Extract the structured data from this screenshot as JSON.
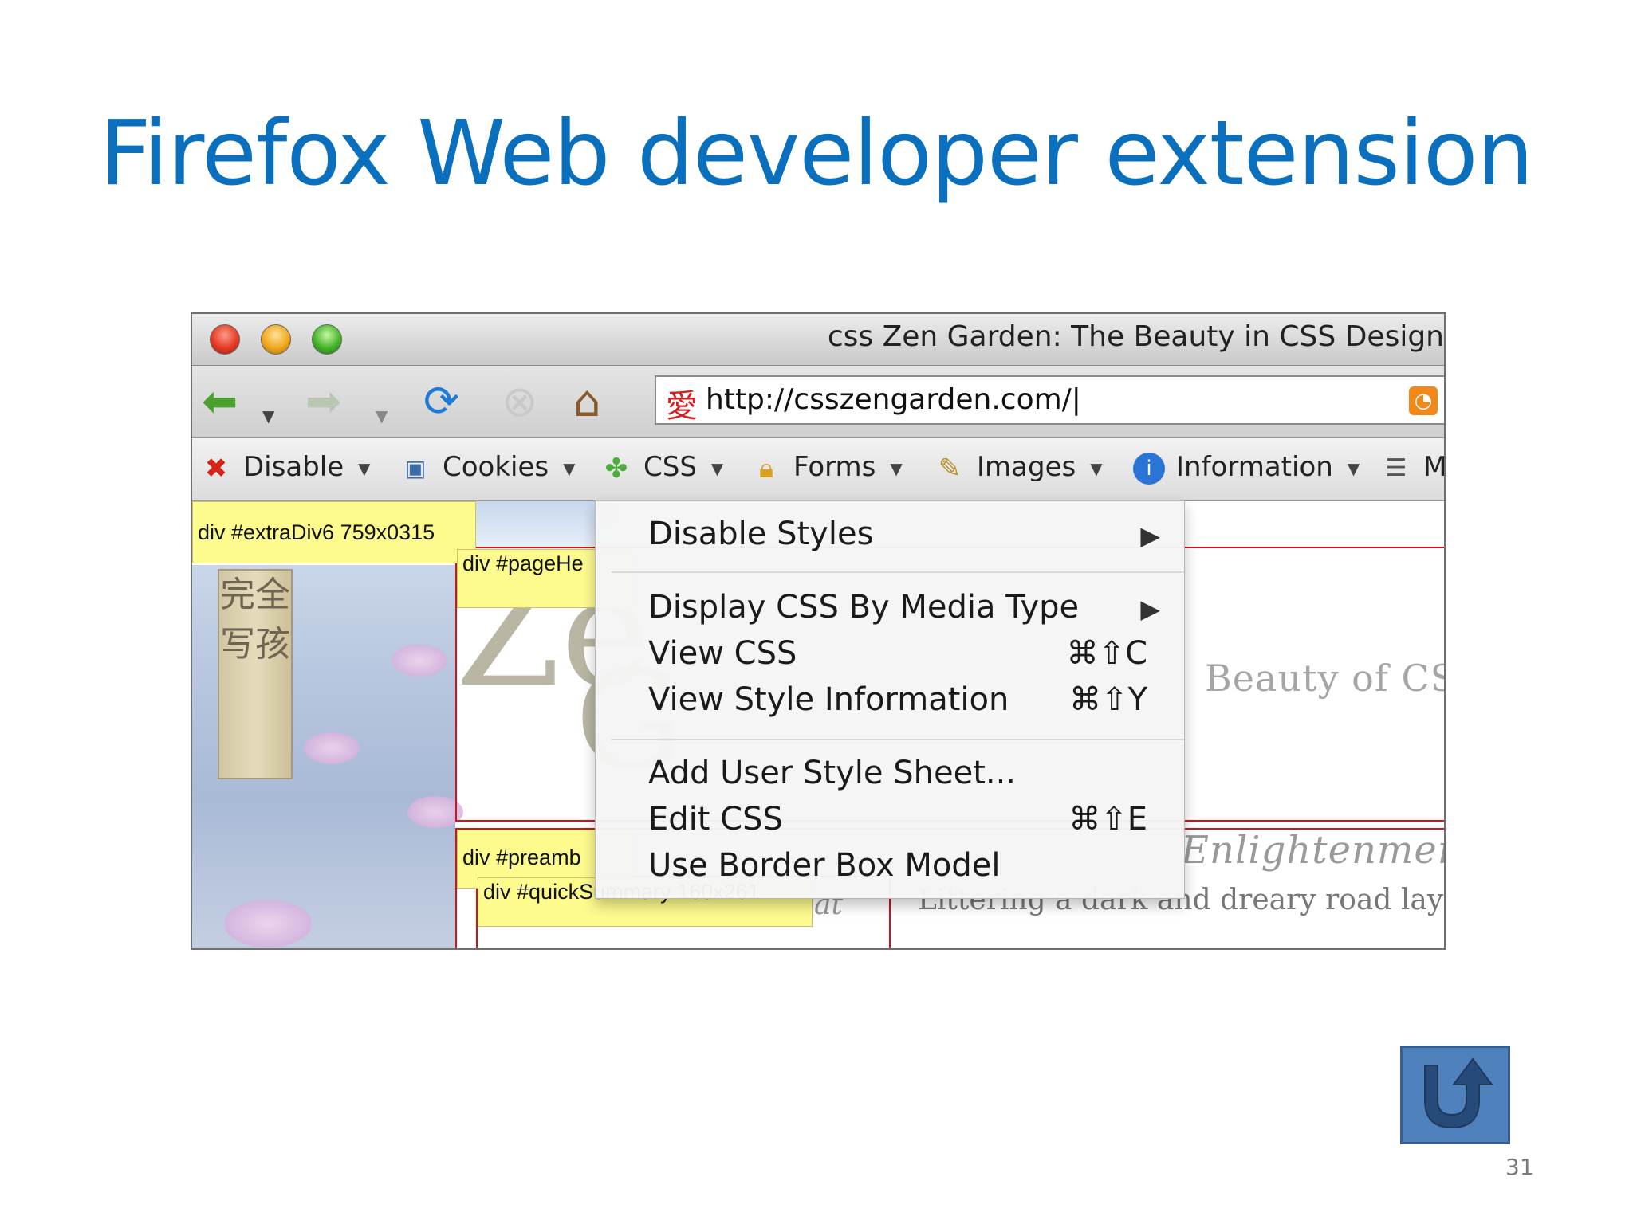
{
  "slide": {
    "title": "Firefox Web developer extension",
    "page_number": "31"
  },
  "window": {
    "title": "css Zen Garden: The Beauty in CSS Design",
    "url": "http://csszengarden.com/|"
  },
  "toolbar": {
    "items": [
      {
        "label": "Disable",
        "icon": "disable-x-icon"
      },
      {
        "label": "Cookies",
        "icon": "cookies-icon"
      },
      {
        "label": "CSS",
        "icon": "css-puzzle-icon"
      },
      {
        "label": "Forms",
        "icon": "forms-lock-icon"
      },
      {
        "label": "Images",
        "icon": "images-wand-icon"
      },
      {
        "label": "Information",
        "icon": "information-icon"
      }
    ],
    "overflow_char": "M"
  },
  "page": {
    "labels": {
      "extra_div": "div #extraDiv6 759x0315",
      "page_header": "div #pageHe",
      "preamble": "div #preamb",
      "quick_summary": "div #quickSummary 160x261"
    },
    "scroll_chars": "完全写孩",
    "zen_text": "Ze",
    "zen_g": "G",
    "beauty_text": "Beauty of CSS",
    "enlight_text": "Enlightenment",
    "dreary_text": "Littering a dark and dreary road lay the",
    "at_text": "at"
  },
  "menu": {
    "items": [
      {
        "label": "Disable Styles",
        "submenu": true,
        "shortcut": ""
      },
      {
        "label": "Display CSS By Media Type",
        "submenu": true,
        "shortcut": ""
      },
      {
        "label": "View CSS",
        "submenu": false,
        "shortcut": "⌘⇧C"
      },
      {
        "label": "View Style Information",
        "submenu": false,
        "shortcut": "⌘⇧Y"
      },
      {
        "label": "Add User Style Sheet...",
        "submenu": false,
        "shortcut": ""
      },
      {
        "label": "Edit CSS",
        "submenu": false,
        "shortcut": "⌘⇧E"
      },
      {
        "label": "Use Border Box Model",
        "submenu": false,
        "shortcut": ""
      }
    ]
  },
  "colors": {
    "title_blue": "#0a6fbc",
    "label_yellow": "#fdfb8e",
    "outline_red": "#d9101a",
    "back_button": "#4f81bd"
  }
}
